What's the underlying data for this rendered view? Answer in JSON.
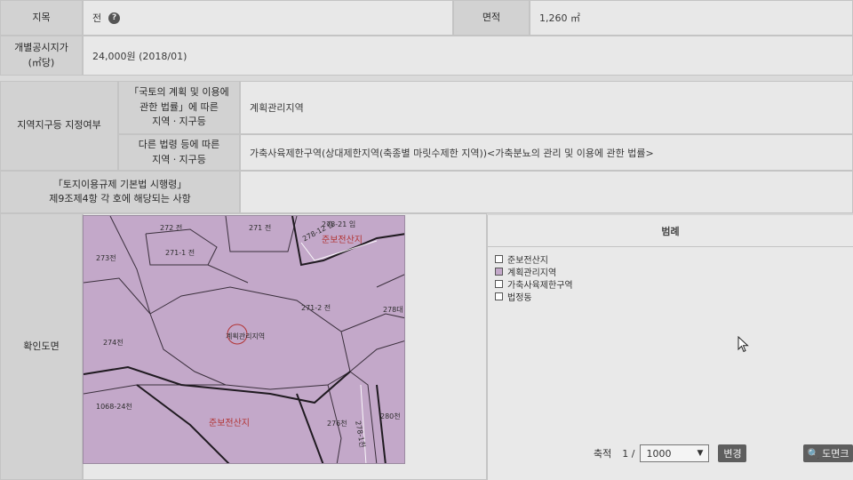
{
  "row_jimok": {
    "label": "지목",
    "value": "전",
    "help_icon": "question-icon",
    "area_label": "면적",
    "area_value": "1,260 ㎡"
  },
  "row_price": {
    "label_line1": "개별공시지가",
    "label_line2": "(㎡당)",
    "value": "24,000원 (2018/01)"
  },
  "row_zone": {
    "label": "지역지구등 지정여부",
    "sub1_line1": "「국토의 계획 및 이용에",
    "sub1_line2": "관한 법률」에 따른",
    "sub1_line3": "지역ㆍ지구등",
    "sub1_value": "계획관리지역",
    "sub2_line1": "다른 법령 등에 따른",
    "sub2_line2": "지역ㆍ지구등",
    "sub2_value": "가축사육제한구역(상대제한지역(축종별 마릿수제한 지역))<가축분뇨의 관리 및 이용에 관한 법률>"
  },
  "row_enforce": {
    "label_line1": "「토지이용규제 기본법 시행령」",
    "label_line2": "제9조제4항 각 호에 해당되는 사항",
    "value": ""
  },
  "row_map": {
    "label": "확인도면"
  },
  "map": {
    "fill_color": "#c3a8c9",
    "parcels": [
      "272 전",
      "271 전",
      "278-21 임",
      "273전",
      "271-1 전",
      "271-2 전",
      "278대",
      "274전",
      "1068-24천",
      "276천",
      "280천",
      "278-1천",
      "278-12 임"
    ],
    "zone_labels": [
      "계획관리지역",
      "준보전산지",
      "준보전산지"
    ]
  },
  "legend": {
    "title": "범례",
    "items": [
      {
        "label": "준보전산지",
        "color": "#ffffff"
      },
      {
        "label": "계획관리지역",
        "color": "#c3a8c9"
      },
      {
        "label": "가축사육제한구역",
        "color": "#ffffff"
      },
      {
        "label": "법정동",
        "color": "#ffffff"
      }
    ]
  },
  "scale": {
    "label": "축적",
    "prefix": "1 /",
    "value": "1000",
    "button": "변경",
    "print_button": "도면크"
  }
}
